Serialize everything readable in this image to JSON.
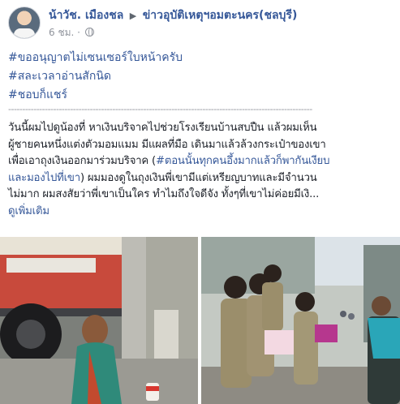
{
  "post": {
    "author": "น้าวัช. เมืองชล",
    "group": "ข่าวอุบัติเหตุฯอมตะนคร(ชลบุรี)",
    "time": "6 ชม.",
    "hashtags": [
      "#ขออนุญาตไม่เซนเซอร์ใบหน้าครับ",
      "#สละเวลาอ่านสักนิด",
      "#ชอบก็แชร์"
    ],
    "divider_text": "------------------------------------------------------------------------------------------------------------",
    "body": {
      "line1": "วันนี้ผมไปดูน้องที่ หาเงินบริจาคไปช่วยโรงเรียนบ้านสบปืน แล้วผมเห็น",
      "line2": "ผู้ชายคนหนึ่งแต่งตัวมอมแมม มีแผลที่มือ เดินมาแล้วล้วงกระเป๋าของเขา",
      "line3_pre": "เพื่อเอาถุงเงินออกมาร่วมบริจาค (",
      "line3_tag": "#ตอนนั้นทุกคนอึ้งมากแล้วก็พากันเงียบ",
      "line4_tag": "และมองไปที่เขา",
      "line4_post": ") ผมมองดูในถุงเงินพี่เขามีแต่เหรียญบาทและมีจำนวน",
      "line5": "ไม่มาก ผมสงสัยว่าพี่เขาเป็นใคร ทำไมถึงใจดีจัง ทั้งๆที่เขาไม่ค่อยมีเงิ...",
      "see_more": "ดูเพิ่มเติม"
    }
  },
  "icons": {
    "avatar": "profile-photo",
    "arrow": "right-triangle-icon",
    "privacy": "globe-icon"
  },
  "colors": {
    "link": "#365899",
    "text": "#1d2129",
    "meta": "#90949c"
  }
}
